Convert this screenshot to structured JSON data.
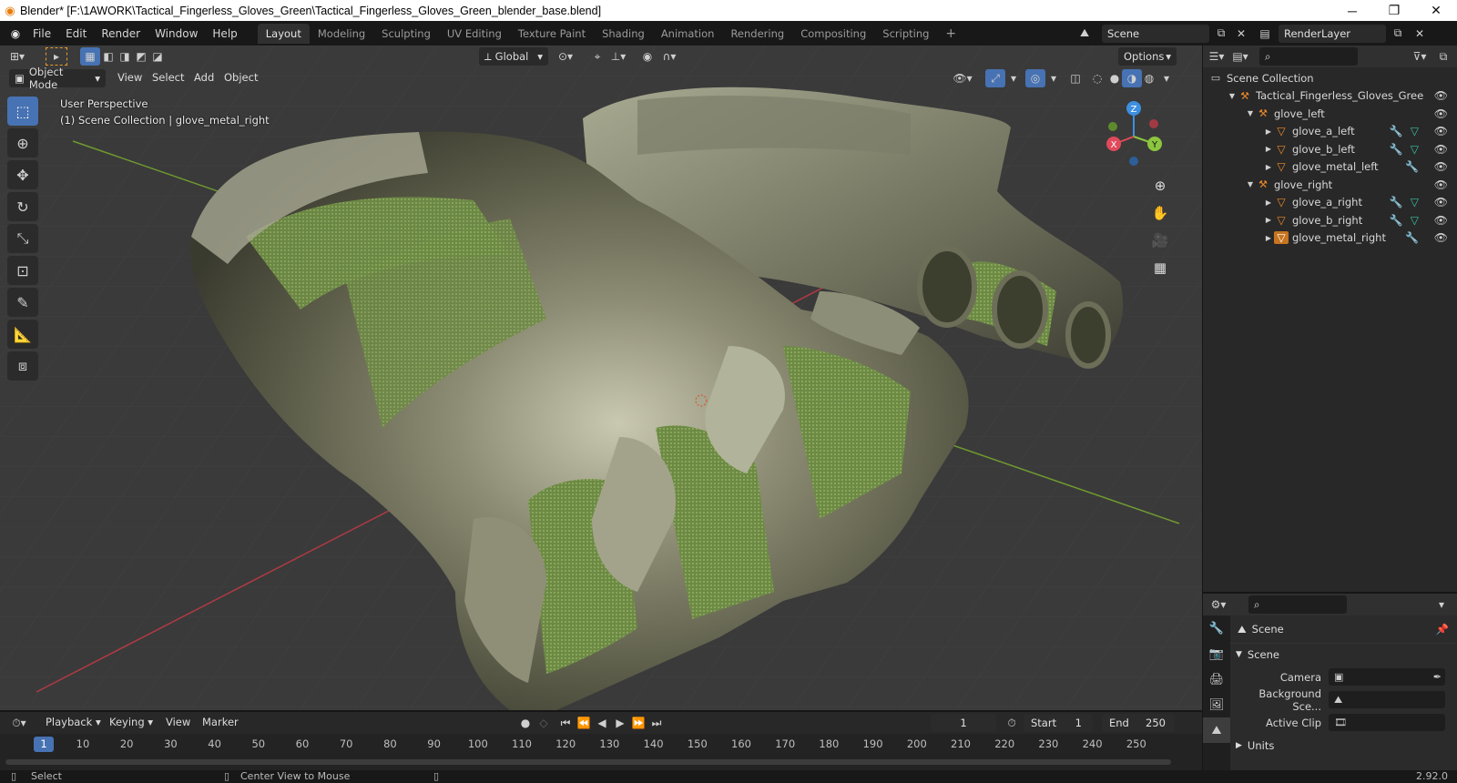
{
  "window": {
    "title": "Blender* [F:\\1AWORK\\Tactical_Fingerless_Gloves_Green\\Tactical_Fingerless_Gloves_Green_blender_base.blend]",
    "minimize": "─",
    "maximize": "❐",
    "close": "✕"
  },
  "menu": [
    "File",
    "Edit",
    "Render",
    "Window",
    "Help"
  ],
  "workspaces": [
    {
      "label": "Layout",
      "active": true
    },
    {
      "label": "Modeling"
    },
    {
      "label": "Sculpting"
    },
    {
      "label": "UV Editing"
    },
    {
      "label": "Texture Paint"
    },
    {
      "label": "Shading"
    },
    {
      "label": "Animation"
    },
    {
      "label": "Rendering"
    },
    {
      "label": "Compositing"
    },
    {
      "label": "Scripting"
    }
  ],
  "scene_field": "Scene",
  "view_layer_field": "RenderLayer",
  "viewport": {
    "mode": "Object Mode",
    "menus": [
      "View",
      "Select",
      "Add",
      "Object"
    ],
    "transform_orientation": "Global",
    "options": "Options",
    "perspective": "User Perspective",
    "collection_info": "(1) Scene Collection | glove_metal_right",
    "gizmo": {
      "x": "X",
      "y": "Y",
      "z": "Z"
    }
  },
  "outliner": {
    "root": "Scene Collection",
    "rows": [
      {
        "label": "Tactical_Fingerless_Gloves_Gree",
        "level": 1,
        "type": "collection",
        "expanded": true
      },
      {
        "label": "glove_left",
        "level": 2,
        "type": "collection",
        "expanded": true
      },
      {
        "label": "glove_a_left",
        "level": 3,
        "type": "mesh",
        "mods": [
          "wrench",
          "mesh"
        ]
      },
      {
        "label": "glove_b_left",
        "level": 3,
        "type": "mesh",
        "mods": [
          "wrench",
          "mesh"
        ]
      },
      {
        "label": "glove_metal_left",
        "level": 3,
        "type": "mesh",
        "mods": [
          "wrench"
        ]
      },
      {
        "label": "glove_right",
        "level": 2,
        "type": "collection",
        "expanded": true
      },
      {
        "label": "glove_a_right",
        "level": 3,
        "type": "mesh",
        "mods": [
          "wrench",
          "mesh"
        ]
      },
      {
        "label": "glove_b_right",
        "level": 3,
        "type": "mesh",
        "mods": [
          "wrench",
          "mesh"
        ]
      },
      {
        "label": "glove_metal_right",
        "level": 3,
        "type": "mesh",
        "mods": [
          "wrench"
        ],
        "selected": true
      }
    ]
  },
  "properties": {
    "context": "Scene",
    "panel": "Scene",
    "fields": [
      {
        "label": "Camera"
      },
      {
        "label": "Background Sce..."
      },
      {
        "label": "Active Clip"
      }
    ],
    "next_panel": "Units"
  },
  "timeline": {
    "menus": [
      "Playback",
      "Keying",
      "View",
      "Marker"
    ],
    "current_frame": "1",
    "start_label": "Start",
    "start": "1",
    "end_label": "End",
    "end": "250",
    "ticks": [
      "10",
      "20",
      "30",
      "40",
      "50",
      "60",
      "70",
      "80",
      "90",
      "100",
      "110",
      "120",
      "130",
      "140",
      "150",
      "160",
      "170",
      "180",
      "190",
      "200",
      "210",
      "220",
      "230",
      "240",
      "250"
    ]
  },
  "status": {
    "left": "Select",
    "middle": "Center View to Mouse",
    "version": "2.92.0"
  },
  "colors": {
    "accent": "#4772b3",
    "object_orange": "#f08b2a",
    "modifier_blue": "#6a9ce0",
    "mesh_green": "#39c2a0",
    "x_axis": "#e04a5a",
    "y_axis": "#8cc63f",
    "z_axis": "#3d8fe0"
  }
}
